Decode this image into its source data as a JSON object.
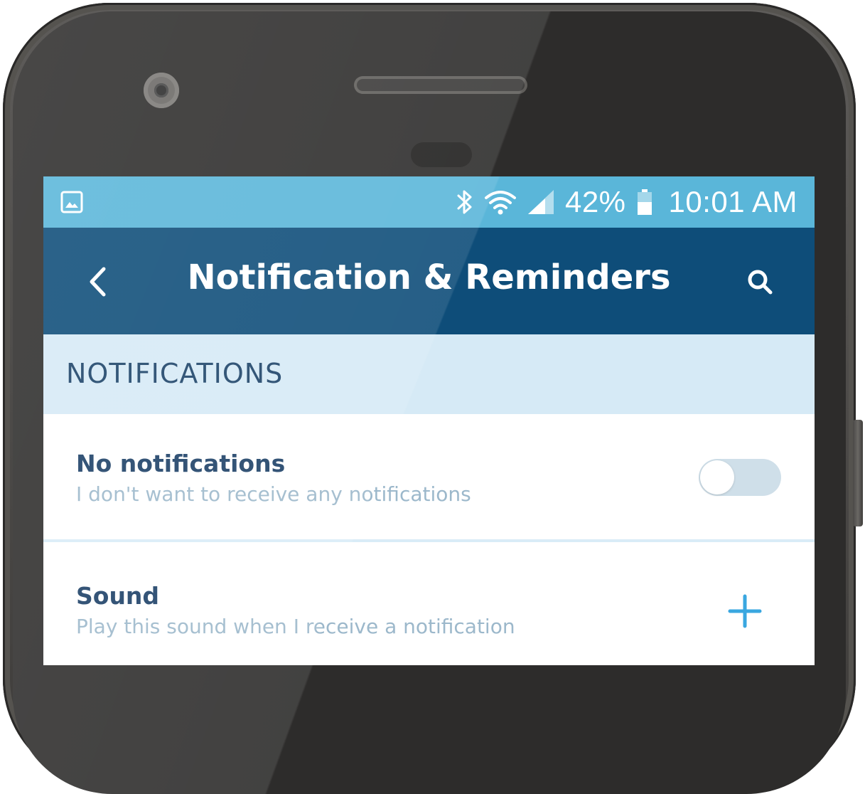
{
  "status_bar": {
    "battery_percent": "42%",
    "time": "10:01 AM",
    "icons": [
      "image-icon",
      "bluetooth-icon",
      "wifi-icon",
      "cell-signal-icon",
      "battery-icon"
    ]
  },
  "app_bar": {
    "title": "Notification & Reminders",
    "back_icon": "chevron-left-icon",
    "search_icon": "search-icon"
  },
  "section": {
    "header": "NOTIFICATIONS"
  },
  "rows": [
    {
      "title": "No notifications",
      "subtitle": "I don't want to receive any notifications",
      "control": "toggle",
      "toggle_on": false
    },
    {
      "title": "Sound",
      "subtitle": "Play this sound when I receive a notification",
      "control": "plus-icon"
    }
  ],
  "colors": {
    "status_bar": "#5ab6d9",
    "app_bar": "#0e4d79",
    "section_header_bg": "#d6eaf6",
    "section_header_text": "#1b4268",
    "row_title": "#1b3f66",
    "row_subtitle": "#9cb8cb",
    "accent": "#3aa7e0"
  }
}
